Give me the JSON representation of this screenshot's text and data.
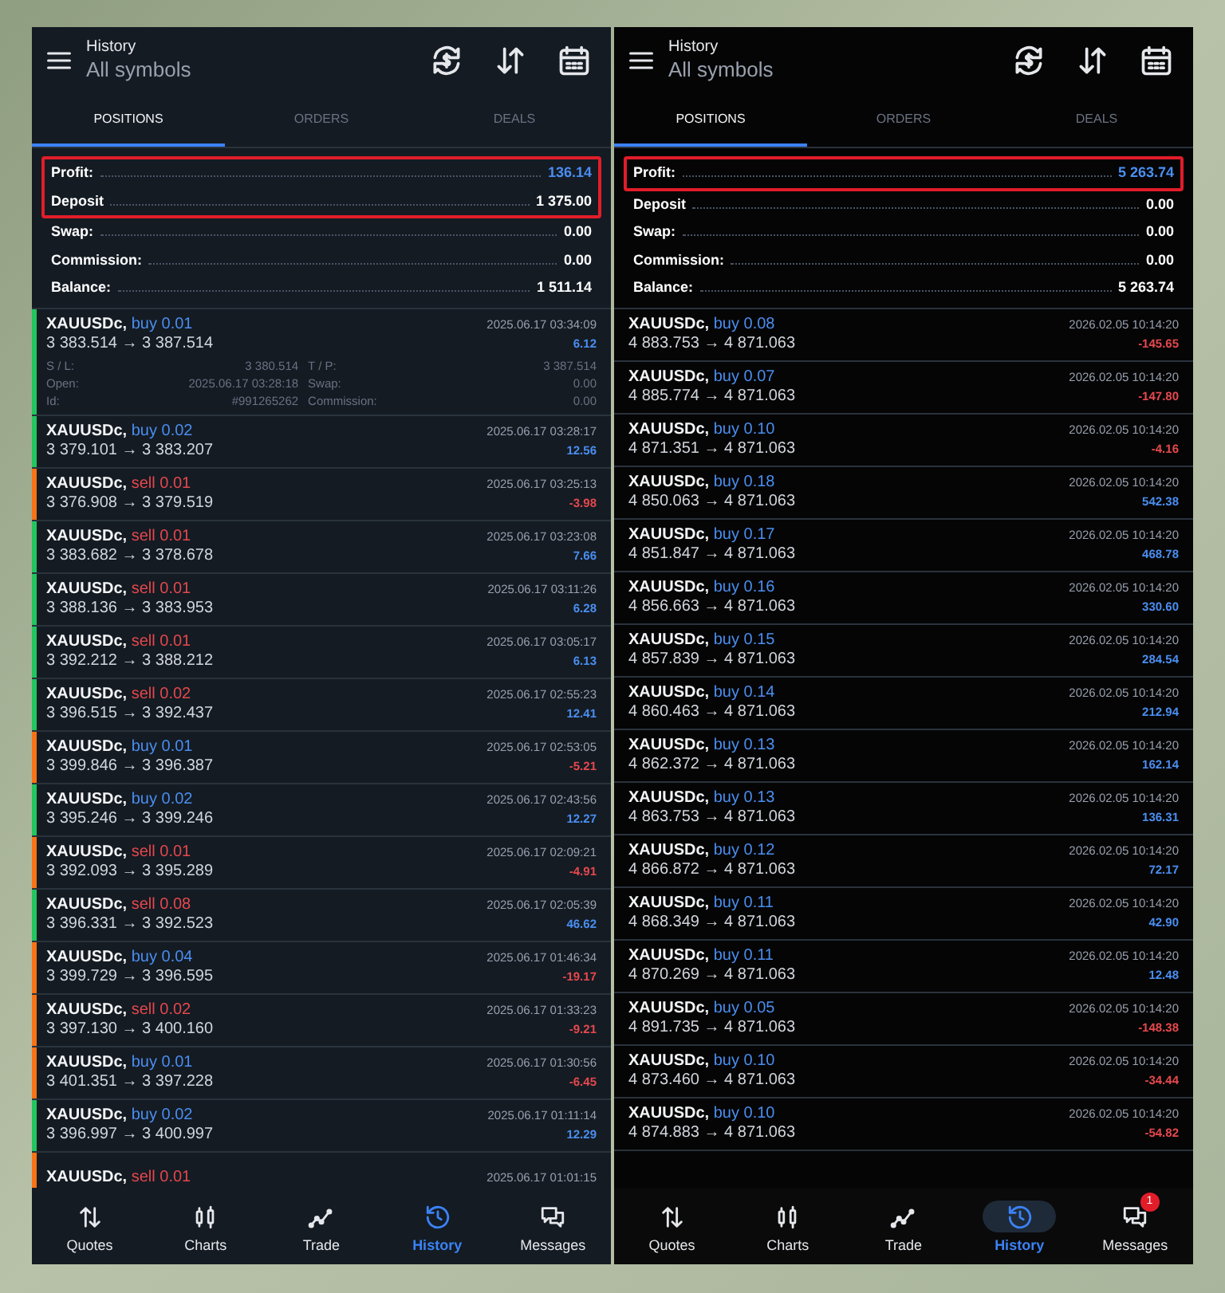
{
  "screens": [
    {
      "title": "History",
      "subtitle": "All symbols",
      "tabs": [
        {
          "label": "POSITIONS",
          "selected": true
        },
        {
          "label": "ORDERS",
          "selected": false
        },
        {
          "label": "DEALS",
          "selected": false
        }
      ],
      "summary": [
        {
          "label": "Profit:",
          "value": "136.14",
          "accent": true,
          "highlighted": true
        },
        {
          "label": "Deposit",
          "value": "1 375.00",
          "accent": false,
          "highlighted": true
        },
        {
          "label": "Swap:",
          "value": "0.00",
          "accent": false,
          "highlighted": false
        },
        {
          "label": "Commission:",
          "value": "0.00",
          "accent": false,
          "highlighted": false
        },
        {
          "label": "Balance:",
          "value": "1 511.14",
          "accent": false,
          "highlighted": false
        }
      ],
      "positions": [
        {
          "symbol": "XAUUSDc,",
          "order": "buy 0.01",
          "kind": "buy",
          "prices": "3 383.514 → 3 387.514",
          "time": "2025.06.17 03:34:09",
          "profit": "6.12",
          "negative": false,
          "color": "#22c55e",
          "details": [
            {
              "label": "S / L:",
              "value": "3 380.514"
            },
            {
              "label": "T / P:",
              "value": "3 387.514"
            },
            {
              "label": "Open:",
              "value": "2025.06.17 03:28:18"
            },
            {
              "label": "Swap:",
              "value": "0.00"
            },
            {
              "label": "Id:",
              "value": "#991265262"
            },
            {
              "label": "Commission:",
              "value": "0.00"
            }
          ]
        },
        {
          "symbol": "XAUUSDc,",
          "order": "buy 0.02",
          "kind": "buy",
          "prices": "3 379.101 → 3 383.207",
          "time": "2025.06.17 03:28:17",
          "profit": "12.56",
          "negative": false,
          "color": "#22c55e"
        },
        {
          "symbol": "XAUUSDc,",
          "order": "sell 0.01",
          "kind": "sell",
          "prices": "3 376.908 → 3 379.519",
          "time": "2025.06.17 03:25:13",
          "profit": "-3.98",
          "negative": true,
          "color": "#f97316"
        },
        {
          "symbol": "XAUUSDc,",
          "order": "sell 0.01",
          "kind": "sell",
          "prices": "3 383.682 → 3 378.678",
          "time": "2025.06.17 03:23:08",
          "profit": "7.66",
          "negative": false,
          "color": "#22c55e"
        },
        {
          "symbol": "XAUUSDc,",
          "order": "sell 0.01",
          "kind": "sell",
          "prices": "3 388.136 → 3 383.953",
          "time": "2025.06.17 03:11:26",
          "profit": "6.28",
          "negative": false,
          "color": "#22c55e"
        },
        {
          "symbol": "XAUUSDc,",
          "order": "sell 0.01",
          "kind": "sell",
          "prices": "3 392.212 → 3 388.212",
          "time": "2025.06.17 03:05:17",
          "profit": "6.13",
          "negative": false,
          "color": "#22c55e"
        },
        {
          "symbol": "XAUUSDc,",
          "order": "sell 0.02",
          "kind": "sell",
          "prices": "3 396.515 → 3 392.437",
          "time": "2025.06.17 02:55:23",
          "profit": "12.41",
          "negative": false,
          "color": "#22c55e"
        },
        {
          "symbol": "XAUUSDc,",
          "order": "buy 0.01",
          "kind": "buy",
          "prices": "3 399.846 → 3 396.387",
          "time": "2025.06.17 02:53:05",
          "profit": "-5.21",
          "negative": true,
          "color": "#f97316"
        },
        {
          "symbol": "XAUUSDc,",
          "order": "buy 0.02",
          "kind": "buy",
          "prices": "3 395.246 → 3 399.246",
          "time": "2025.06.17 02:43:56",
          "profit": "12.27",
          "negative": false,
          "color": "#22c55e"
        },
        {
          "symbol": "XAUUSDc,",
          "order": "sell 0.01",
          "kind": "sell",
          "prices": "3 392.093 → 3 395.289",
          "time": "2025.06.17 02:09:21",
          "profit": "-4.91",
          "negative": true,
          "color": "#f97316"
        },
        {
          "symbol": "XAUUSDc,",
          "order": "sell 0.08",
          "kind": "sell",
          "prices": "3 396.331 → 3 392.523",
          "time": "2025.06.17 02:05:39",
          "profit": "46.62",
          "negative": false,
          "color": "#22c55e"
        },
        {
          "symbol": "XAUUSDc,",
          "order": "buy 0.04",
          "kind": "buy",
          "prices": "3 399.729 → 3 396.595",
          "time": "2025.06.17 01:46:34",
          "profit": "-19.17",
          "negative": true,
          "color": "#f97316"
        },
        {
          "symbol": "XAUUSDc,",
          "order": "sell 0.02",
          "kind": "sell",
          "prices": "3 397.130 → 3 400.160",
          "time": "2025.06.17 01:33:23",
          "profit": "-9.21",
          "negative": true,
          "color": "#f97316"
        },
        {
          "symbol": "XAUUSDc,",
          "order": "buy 0.01",
          "kind": "buy",
          "prices": "3 401.351 → 3 397.228",
          "time": "2025.06.17 01:30:56",
          "profit": "-6.45",
          "negative": true,
          "color": "#f97316"
        },
        {
          "symbol": "XAUUSDc,",
          "order": "buy 0.02",
          "kind": "buy",
          "prices": "3 396.997 → 3 400.997",
          "time": "2025.06.17 01:11:14",
          "profit": "12.29",
          "negative": false,
          "color": "#22c55e"
        },
        {
          "symbol": "XAUUSDc,",
          "order": "sell 0.01",
          "kind": "sell",
          "time": "2025.06.17 01:01:15",
          "color": "#f97316"
        }
      ],
      "nav": [
        {
          "label": "Quotes",
          "selected": false
        },
        {
          "label": "Charts",
          "selected": false
        },
        {
          "label": "Trade",
          "selected": false
        },
        {
          "label": "History",
          "selected": true
        },
        {
          "label": "Messages",
          "selected": false
        }
      ]
    },
    {
      "title": "History",
      "subtitle": "All symbols",
      "tabs": [
        {
          "label": "POSITIONS",
          "selected": true
        },
        {
          "label": "ORDERS",
          "selected": false
        },
        {
          "label": "DEALS",
          "selected": false
        }
      ],
      "summary": [
        {
          "label": "Profit:",
          "value": "5 263.74",
          "accent": true,
          "highlighted": true
        },
        {
          "label": "Deposit",
          "value": "0.00",
          "accent": false,
          "highlighted": false
        },
        {
          "label": "Swap:",
          "value": "0.00",
          "accent": false,
          "highlighted": false
        },
        {
          "label": "Commission:",
          "value": "0.00",
          "accent": false,
          "highlighted": false
        },
        {
          "label": "Balance:",
          "value": "5 263.74",
          "accent": false,
          "highlighted": false
        }
      ],
      "positions": [
        {
          "symbol": "XAUUSDc,",
          "order": "buy 0.08",
          "kind": "buy",
          "prices": "4 883.753 → 4 871.063",
          "time": "2026.02.05 10:14:20",
          "profit": "-145.65",
          "negative": true
        },
        {
          "symbol": "XAUUSDc,",
          "order": "buy 0.07",
          "kind": "buy",
          "prices": "4 885.774 → 4 871.063",
          "time": "2026.02.05 10:14:20",
          "profit": "-147.80",
          "negative": true
        },
        {
          "symbol": "XAUUSDc,",
          "order": "buy 0.10",
          "kind": "buy",
          "prices": "4 871.351 → 4 871.063",
          "time": "2026.02.05 10:14:20",
          "profit": "-4.16",
          "negative": true
        },
        {
          "symbol": "XAUUSDc,",
          "order": "buy 0.18",
          "kind": "buy",
          "prices": "4 850.063 → 4 871.063",
          "time": "2026.02.05 10:14:20",
          "profit": "542.38",
          "negative": false
        },
        {
          "symbol": "XAUUSDc,",
          "order": "buy 0.17",
          "kind": "buy",
          "prices": "4 851.847 → 4 871.063",
          "time": "2026.02.05 10:14:20",
          "profit": "468.78",
          "negative": false
        },
        {
          "symbol": "XAUUSDc,",
          "order": "buy 0.16",
          "kind": "buy",
          "prices": "4 856.663 → 4 871.063",
          "time": "2026.02.05 10:14:20",
          "profit": "330.60",
          "negative": false
        },
        {
          "symbol": "XAUUSDc,",
          "order": "buy 0.15",
          "kind": "buy",
          "prices": "4 857.839 → 4 871.063",
          "time": "2026.02.05 10:14:20",
          "profit": "284.54",
          "negative": false
        },
        {
          "symbol": "XAUUSDc,",
          "order": "buy 0.14",
          "kind": "buy",
          "prices": "4 860.463 → 4 871.063",
          "time": "2026.02.05 10:14:20",
          "profit": "212.94",
          "negative": false
        },
        {
          "symbol": "XAUUSDc,",
          "order": "buy 0.13",
          "kind": "buy",
          "prices": "4 862.372 → 4 871.063",
          "time": "2026.02.05 10:14:20",
          "profit": "162.14",
          "negative": false
        },
        {
          "symbol": "XAUUSDc,",
          "order": "buy 0.13",
          "kind": "buy",
          "prices": "4 863.753 → 4 871.063",
          "time": "2026.02.05 10:14:20",
          "profit": "136.31",
          "negative": false
        },
        {
          "symbol": "XAUUSDc,",
          "order": "buy 0.12",
          "kind": "buy",
          "prices": "4 866.872 → 4 871.063",
          "time": "2026.02.05 10:14:20",
          "profit": "72.17",
          "negative": false
        },
        {
          "symbol": "XAUUSDc,",
          "order": "buy 0.11",
          "kind": "buy",
          "prices": "4 868.349 → 4 871.063",
          "time": "2026.02.05 10:14:20",
          "profit": "42.90",
          "negative": false
        },
        {
          "symbol": "XAUUSDc,",
          "order": "buy 0.11",
          "kind": "buy",
          "prices": "4 870.269 → 4 871.063",
          "time": "2026.02.05 10:14:20",
          "profit": "12.48",
          "negative": false
        },
        {
          "symbol": "XAUUSDc,",
          "order": "buy 0.05",
          "kind": "buy",
          "prices": "4 891.735 → 4 871.063",
          "time": "2026.02.05 10:14:20",
          "profit": "-148.38",
          "negative": true
        },
        {
          "symbol": "XAUUSDc,",
          "order": "buy 0.10",
          "kind": "buy",
          "prices": "4 873.460 → 4 871.063",
          "time": "2026.02.05 10:14:20",
          "profit": "-34.44",
          "negative": true
        },
        {
          "symbol": "XAUUSDc,",
          "order": "buy 0.10",
          "kind": "buy",
          "prices": "4 874.883 → 4 871.063",
          "time": "2026.02.05 10:14:20",
          "profit": "-54.82",
          "negative": true
        }
      ],
      "nav": [
        {
          "label": "Quotes",
          "selected": false
        },
        {
          "label": "Charts",
          "selected": false
        },
        {
          "label": "Trade",
          "selected": false
        },
        {
          "label": "History",
          "selected": true
        },
        {
          "label": "Messages",
          "selected": false,
          "badge": "1"
        }
      ]
    }
  ]
}
